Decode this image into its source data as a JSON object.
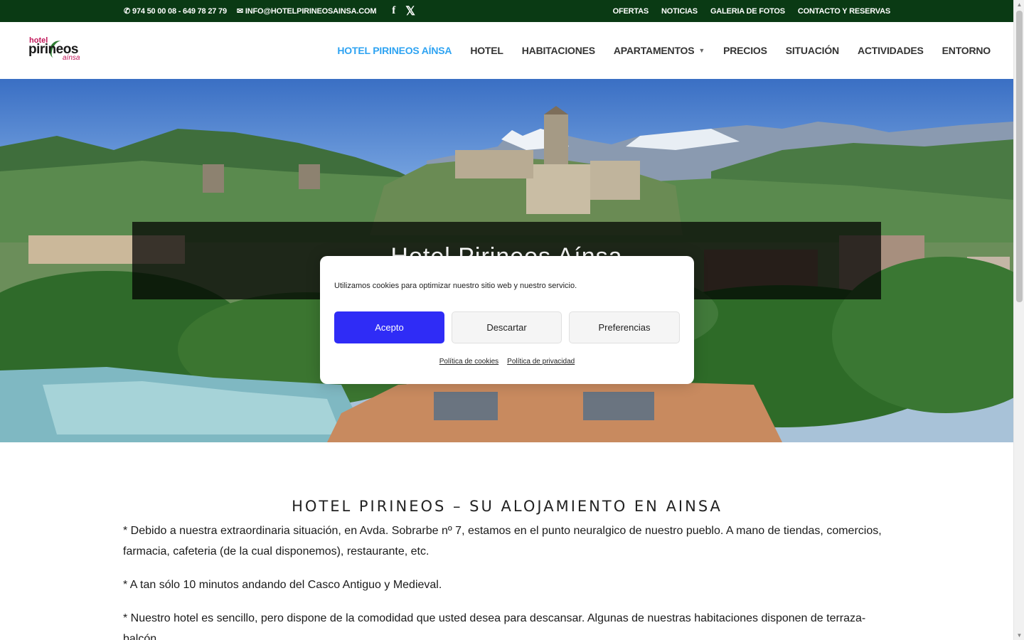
{
  "topbar": {
    "phone": "974 50 00 08 - 649 78 27 79",
    "email": "INFO@HOTELPIRINEOSAINSA.COM",
    "social": [
      "facebook-icon",
      "x-icon"
    ],
    "links": [
      "OFERTAS",
      "NOTICIAS",
      "GALERIA DE FOTOS",
      "CONTACTO Y RESERVAS"
    ]
  },
  "logo": {
    "line1": "hotel",
    "line2": "pirineos",
    "line3": "aínsa"
  },
  "nav": {
    "items": [
      {
        "label": "HOTEL PIRINEOS AÍNSA",
        "active": true
      },
      {
        "label": "HOTEL"
      },
      {
        "label": "HABITACIONES"
      },
      {
        "label": "APARTAMENTOS",
        "has_submenu": true
      },
      {
        "label": "PRECIOS"
      },
      {
        "label": "SITUACIÓN"
      },
      {
        "label": "ACTIVIDADES"
      },
      {
        "label": "ENTORNO"
      }
    ],
    "active_color": "#2ea3f2"
  },
  "hero": {
    "title": "Hotel Pirineos Aínsa"
  },
  "cookie": {
    "message": "Utilizamos cookies para optimizar nuestro sitio web y nuestro servicio.",
    "accept": "Acepto",
    "deny": "Descartar",
    "preferences": "Preferencias",
    "cookie_policy": "Política de cookies",
    "privacy_policy": "Política de privacidad",
    "accent": "#2f2cf6"
  },
  "content": {
    "heading": "HOTEL PIRINEOS – SU ALOJAMIENTO EN AINSA",
    "paragraphs": [
      "* Debido a nuestra extraordinaria situación, en Avda. Sobrarbe nº 7, estamos en el punto neuralgico de nuestro pueblo. A mano de tiendas, comercios, farmacia, cafeteria (de la cual disponemos), restaurante, etc.",
      "* A tan sólo 10 minutos andando del Casco Antiguo y Medieval.",
      "* Nuestro hotel es sencillo, pero dispone de la comodidad que usted desea para descansar. Algunas de nuestras habitaciones disponen de terraza-balcón."
    ]
  },
  "colors": {
    "topbar_bg": "#0a3a14"
  }
}
